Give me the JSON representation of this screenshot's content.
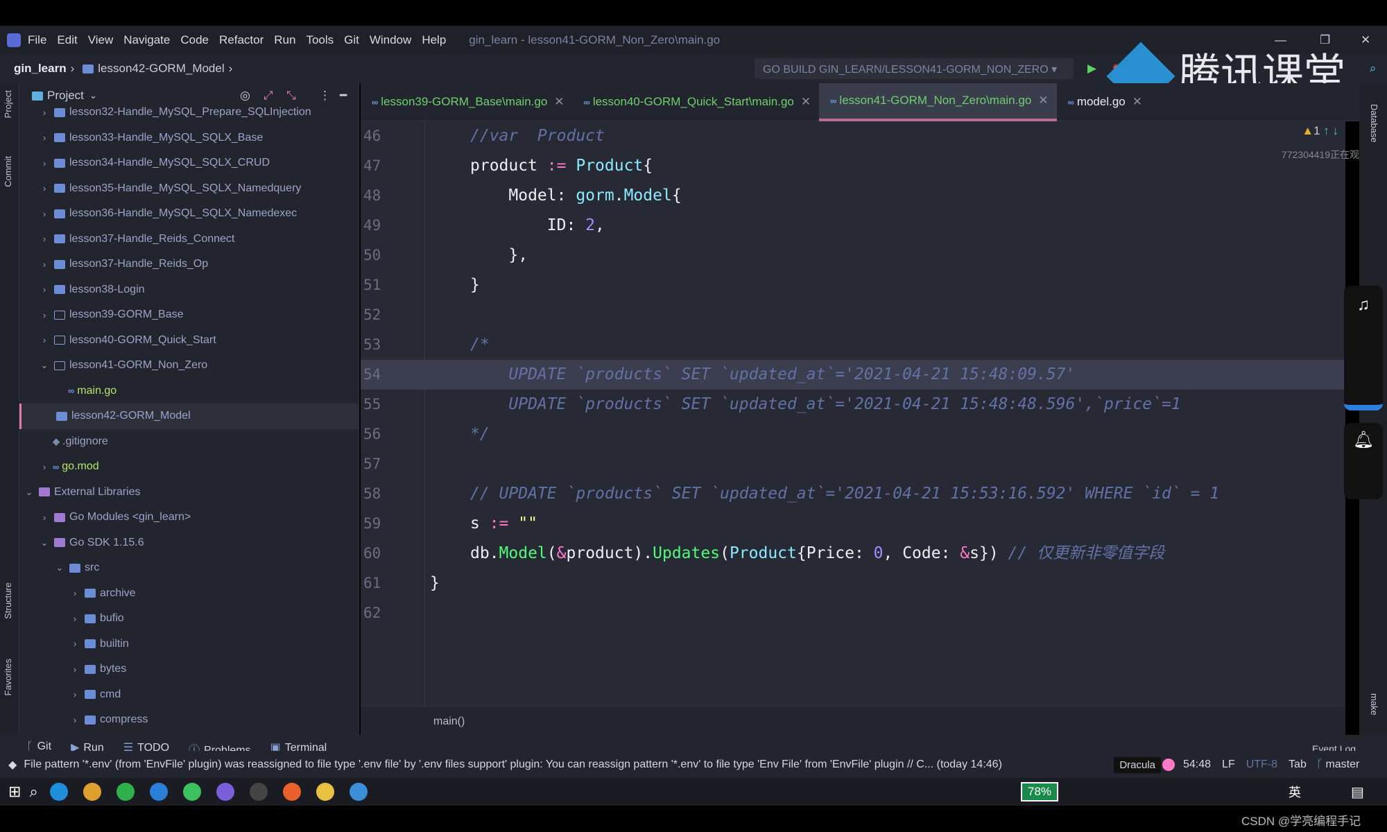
{
  "menu": {
    "items": [
      "File",
      "Edit",
      "View",
      "Navigate",
      "Code",
      "Refactor",
      "Run",
      "Tools",
      "Git",
      "Window",
      "Help"
    ],
    "window_title": "gin_learn - lesson41-GORM_Non_Zero\\main.go"
  },
  "breadcrumb": [
    "gin_learn",
    "lesson42-GORM_Model"
  ],
  "run_config": "GO BUILD GIN_LEARN/LESSON41-GORM_NON_ZERO",
  "watermark": "腾讯课堂",
  "viewer_note": "772304419正在观",
  "project": {
    "title": "Project",
    "tree": [
      {
        "label": "lesson32-Handle_MySQL_Prepare_SQLInjection",
        "level": 1,
        "kind": "folder",
        "chev": "›"
      },
      {
        "label": "lesson33-Handle_MySQL_SQLX_Base",
        "level": 1,
        "kind": "folder",
        "chev": "›"
      },
      {
        "label": "lesson34-Handle_MySQL_SQLX_CRUD",
        "level": 1,
        "kind": "folder",
        "chev": "›"
      },
      {
        "label": "lesson35-Handle_MySQL_SQLX_Namedquery",
        "level": 1,
        "kind": "folder",
        "chev": "›"
      },
      {
        "label": "lesson36-Handle_MySQL_SQLX_Namedexec",
        "level": 1,
        "kind": "folder",
        "chev": "›"
      },
      {
        "label": "lesson37-Handle_Reids_Connect",
        "level": 1,
        "kind": "folder",
        "chev": "›"
      },
      {
        "label": "lesson37-Handle_Reids_Op",
        "level": 1,
        "kind": "folder",
        "chev": "›"
      },
      {
        "label": "lesson38-Login",
        "level": 1,
        "kind": "folder",
        "chev": "›"
      },
      {
        "label": "lesson39-GORM_Base",
        "level": 1,
        "kind": "folder-out",
        "chev": "›"
      },
      {
        "label": "lesson40-GORM_Quick_Start",
        "level": 1,
        "kind": "folder-out",
        "chev": "›"
      },
      {
        "label": "lesson41-GORM_Non_Zero",
        "level": 1,
        "kind": "folder-out",
        "chev": "⌄"
      },
      {
        "label": "main.go",
        "level": 2,
        "kind": "go",
        "chev": ""
      },
      {
        "label": "lesson42-GORM_Model",
        "level": 1,
        "kind": "folder",
        "chev": "",
        "selected": true
      },
      {
        "label": ".gitignore",
        "level": 1,
        "kind": "git",
        "chev": ""
      },
      {
        "label": "go.mod",
        "level": 1,
        "kind": "go",
        "chev": "›"
      },
      {
        "label": "External Libraries",
        "level": 0,
        "kind": "lib",
        "chev": "⌄"
      },
      {
        "label": "Go Modules <gin_learn>",
        "level": 1,
        "kind": "lib",
        "chev": "›"
      },
      {
        "label": "Go SDK 1.15.6",
        "level": 1,
        "kind": "lib",
        "chev": "⌄"
      },
      {
        "label": "src",
        "level": 2,
        "kind": "folder",
        "chev": "⌄"
      },
      {
        "label": "archive",
        "level": 3,
        "kind": "folder",
        "chev": "›"
      },
      {
        "label": "bufio",
        "level": 3,
        "kind": "folder",
        "chev": "›"
      },
      {
        "label": "builtin",
        "level": 3,
        "kind": "folder",
        "chev": "›"
      },
      {
        "label": "bytes",
        "level": 3,
        "kind": "folder",
        "chev": "›"
      },
      {
        "label": "cmd",
        "level": 3,
        "kind": "folder",
        "chev": "›"
      },
      {
        "label": "compress",
        "level": 3,
        "kind": "folder",
        "chev": "›"
      }
    ]
  },
  "left_tools": [
    "Project",
    "Commit",
    "Structure",
    "Favorites"
  ],
  "tabs": [
    {
      "label": "lesson39-GORM_Base\\main.go"
    },
    {
      "label": "lesson40-GORM_Quick_Start\\main.go"
    },
    {
      "label": "lesson41-GORM_Non_Zero\\main.go",
      "active": true
    },
    {
      "label": "model.go"
    }
  ],
  "inspection": {
    "warnings": "1"
  },
  "editor": {
    "current_line": 54,
    "lines": [
      {
        "n": "46",
        "t": [
          [
            "//var  Product",
            "cm"
          ]
        ]
      },
      {
        "n": "47",
        "t": [
          [
            "product ",
            "plain"
          ],
          [
            ":=",
            "op"
          ],
          [
            " ",
            "plain"
          ],
          [
            "Product",
            "type"
          ],
          [
            "{",
            "plain"
          ]
        ]
      },
      {
        "n": "48",
        "t": [
          [
            "    Model: ",
            "plain"
          ],
          [
            "gorm",
            "type"
          ],
          [
            ".",
            "plain"
          ],
          [
            "Model",
            "type"
          ],
          [
            "{",
            "plain"
          ]
        ]
      },
      {
        "n": "49",
        "t": [
          [
            "        ID: ",
            "plain"
          ],
          [
            "2",
            "num"
          ],
          [
            ",",
            "plain"
          ]
        ]
      },
      {
        "n": "50",
        "t": [
          [
            "    },",
            "plain"
          ]
        ]
      },
      {
        "n": "51",
        "t": [
          [
            "}",
            "plain"
          ]
        ]
      },
      {
        "n": "52",
        "t": []
      },
      {
        "n": "53",
        "t": [
          [
            "/*",
            "cm"
          ]
        ]
      },
      {
        "n": "54",
        "t": [
          [
            "    UPDATE `products` SET `updated_at`='2021-04-21 15:48:09.57'",
            "cm"
          ]
        ]
      },
      {
        "n": "55",
        "t": [
          [
            "    UPDATE `products` SET `updated_at`='2021-04-21 15:48:48.596',`price`=1",
            "cm"
          ]
        ]
      },
      {
        "n": "56",
        "t": [
          [
            "*/",
            "cm"
          ]
        ]
      },
      {
        "n": "57",
        "t": []
      },
      {
        "n": "58",
        "t": [
          [
            "// UPDATE `products` SET `updated_at`='2021-04-21 15:53:16.592' WHERE `id` = 1",
            "cm"
          ]
        ]
      },
      {
        "n": "59",
        "t": [
          [
            "s ",
            "plain"
          ],
          [
            ":=",
            "op"
          ],
          [
            " ",
            "plain"
          ],
          [
            "\"\"",
            "str"
          ]
        ]
      },
      {
        "n": "60",
        "t": [
          [
            "db.",
            "plain"
          ],
          [
            "Model",
            "fn"
          ],
          [
            "(",
            "plain"
          ],
          [
            "&",
            "op"
          ],
          [
            "product).",
            "plain"
          ],
          [
            "Updates",
            "fn"
          ],
          [
            "(",
            "plain"
          ],
          [
            "Product",
            "type"
          ],
          [
            "{Price: ",
            "plain"
          ],
          [
            "0",
            "num"
          ],
          [
            ", Code: ",
            "plain"
          ],
          [
            "&",
            "op"
          ],
          [
            "s}) ",
            "plain"
          ],
          [
            "// 仅更新非零值字段",
            "cm"
          ]
        ]
      },
      {
        "n": "61",
        "t": [
          [
            "}",
            "plain"
          ]
        ],
        "outdent": true
      },
      {
        "n": "62",
        "t": []
      }
    ]
  },
  "function_breadcrumb": "main()",
  "tool_windows": [
    "Git",
    "Run",
    "TODO",
    "Problems",
    "Terminal"
  ],
  "right_tools": [
    "Database",
    "make"
  ],
  "event_log": "Event Log",
  "status": {
    "message": "File pattern '*.env' (from 'EnvFile' plugin) was reassigned to file type '.env file' by '.env files support' plugin: You can reassign pattern '*.env' to file type 'Env File' from 'EnvFile' plugin // C... (today 14:46)",
    "theme": "Dracula",
    "position": "54:48",
    "line_sep": "LF",
    "encoding": "UTF-8",
    "indent": "Tab",
    "branch": "master"
  },
  "taskbar": {
    "battery": "78%",
    "ime": "英"
  },
  "credit": "CSDN @学亮编程手记",
  "colors": {
    "accent": "#c06b96",
    "background": "#272935",
    "comment": "#6272a4",
    "keyword": "#ff79c6",
    "type": "#8be9fd",
    "function": "#50fa7b"
  }
}
